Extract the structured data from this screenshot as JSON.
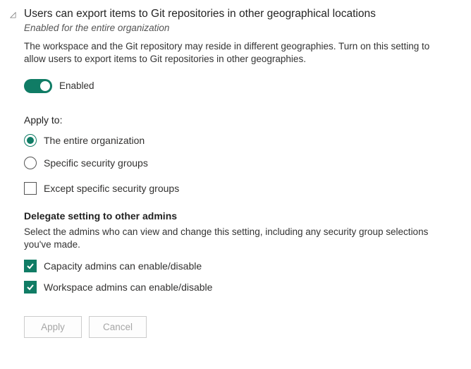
{
  "header": {
    "title": "Users can export items to Git repositories in other geographical locations",
    "subtitle": "Enabled for the entire organization"
  },
  "description": "The workspace and the Git repository may reside in different geographies. Turn on this setting to allow users to export items to Git repositories in other geographies.",
  "toggle": {
    "label": "Enabled",
    "on": true
  },
  "apply": {
    "title": "Apply to:",
    "options": {
      "entire": "The entire organization",
      "specific": "Specific security groups"
    },
    "except": "Except specific security groups"
  },
  "delegate": {
    "title": "Delegate setting to other admins",
    "description": "Select the admins who can view and change this setting, including any security group selections you've made.",
    "capacity": "Capacity admins can enable/disable",
    "workspace": "Workspace admins can enable/disable"
  },
  "buttons": {
    "apply": "Apply",
    "cancel": "Cancel"
  }
}
